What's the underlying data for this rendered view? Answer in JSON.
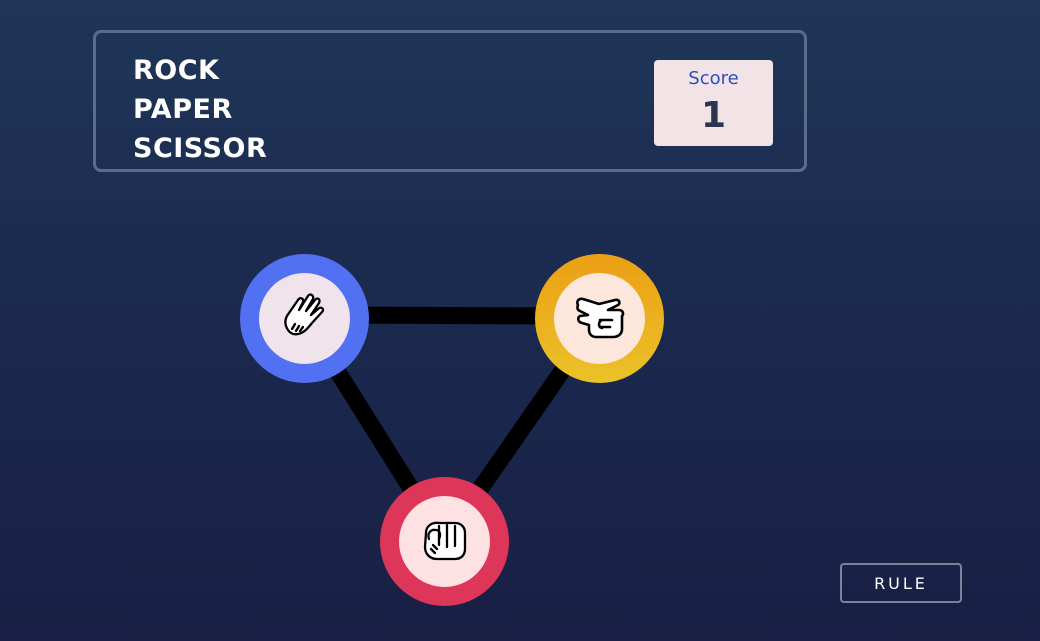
{
  "header": {
    "title_lines": [
      "ROCK",
      "PAPER",
      "SCISSOR"
    ],
    "score_label": "Score",
    "score_value": "1"
  },
  "choices": [
    {
      "name": "paper",
      "icon": "paper-hand-icon",
      "ring_color": "#5270f2"
    },
    {
      "name": "scissor",
      "icon": "scissor-hand-icon",
      "ring_color": "#ebb51f"
    },
    {
      "name": "rock",
      "icon": "rock-fist-icon",
      "ring_color": "#dd3658"
    }
  ],
  "rule_button": {
    "label": "RULE"
  }
}
